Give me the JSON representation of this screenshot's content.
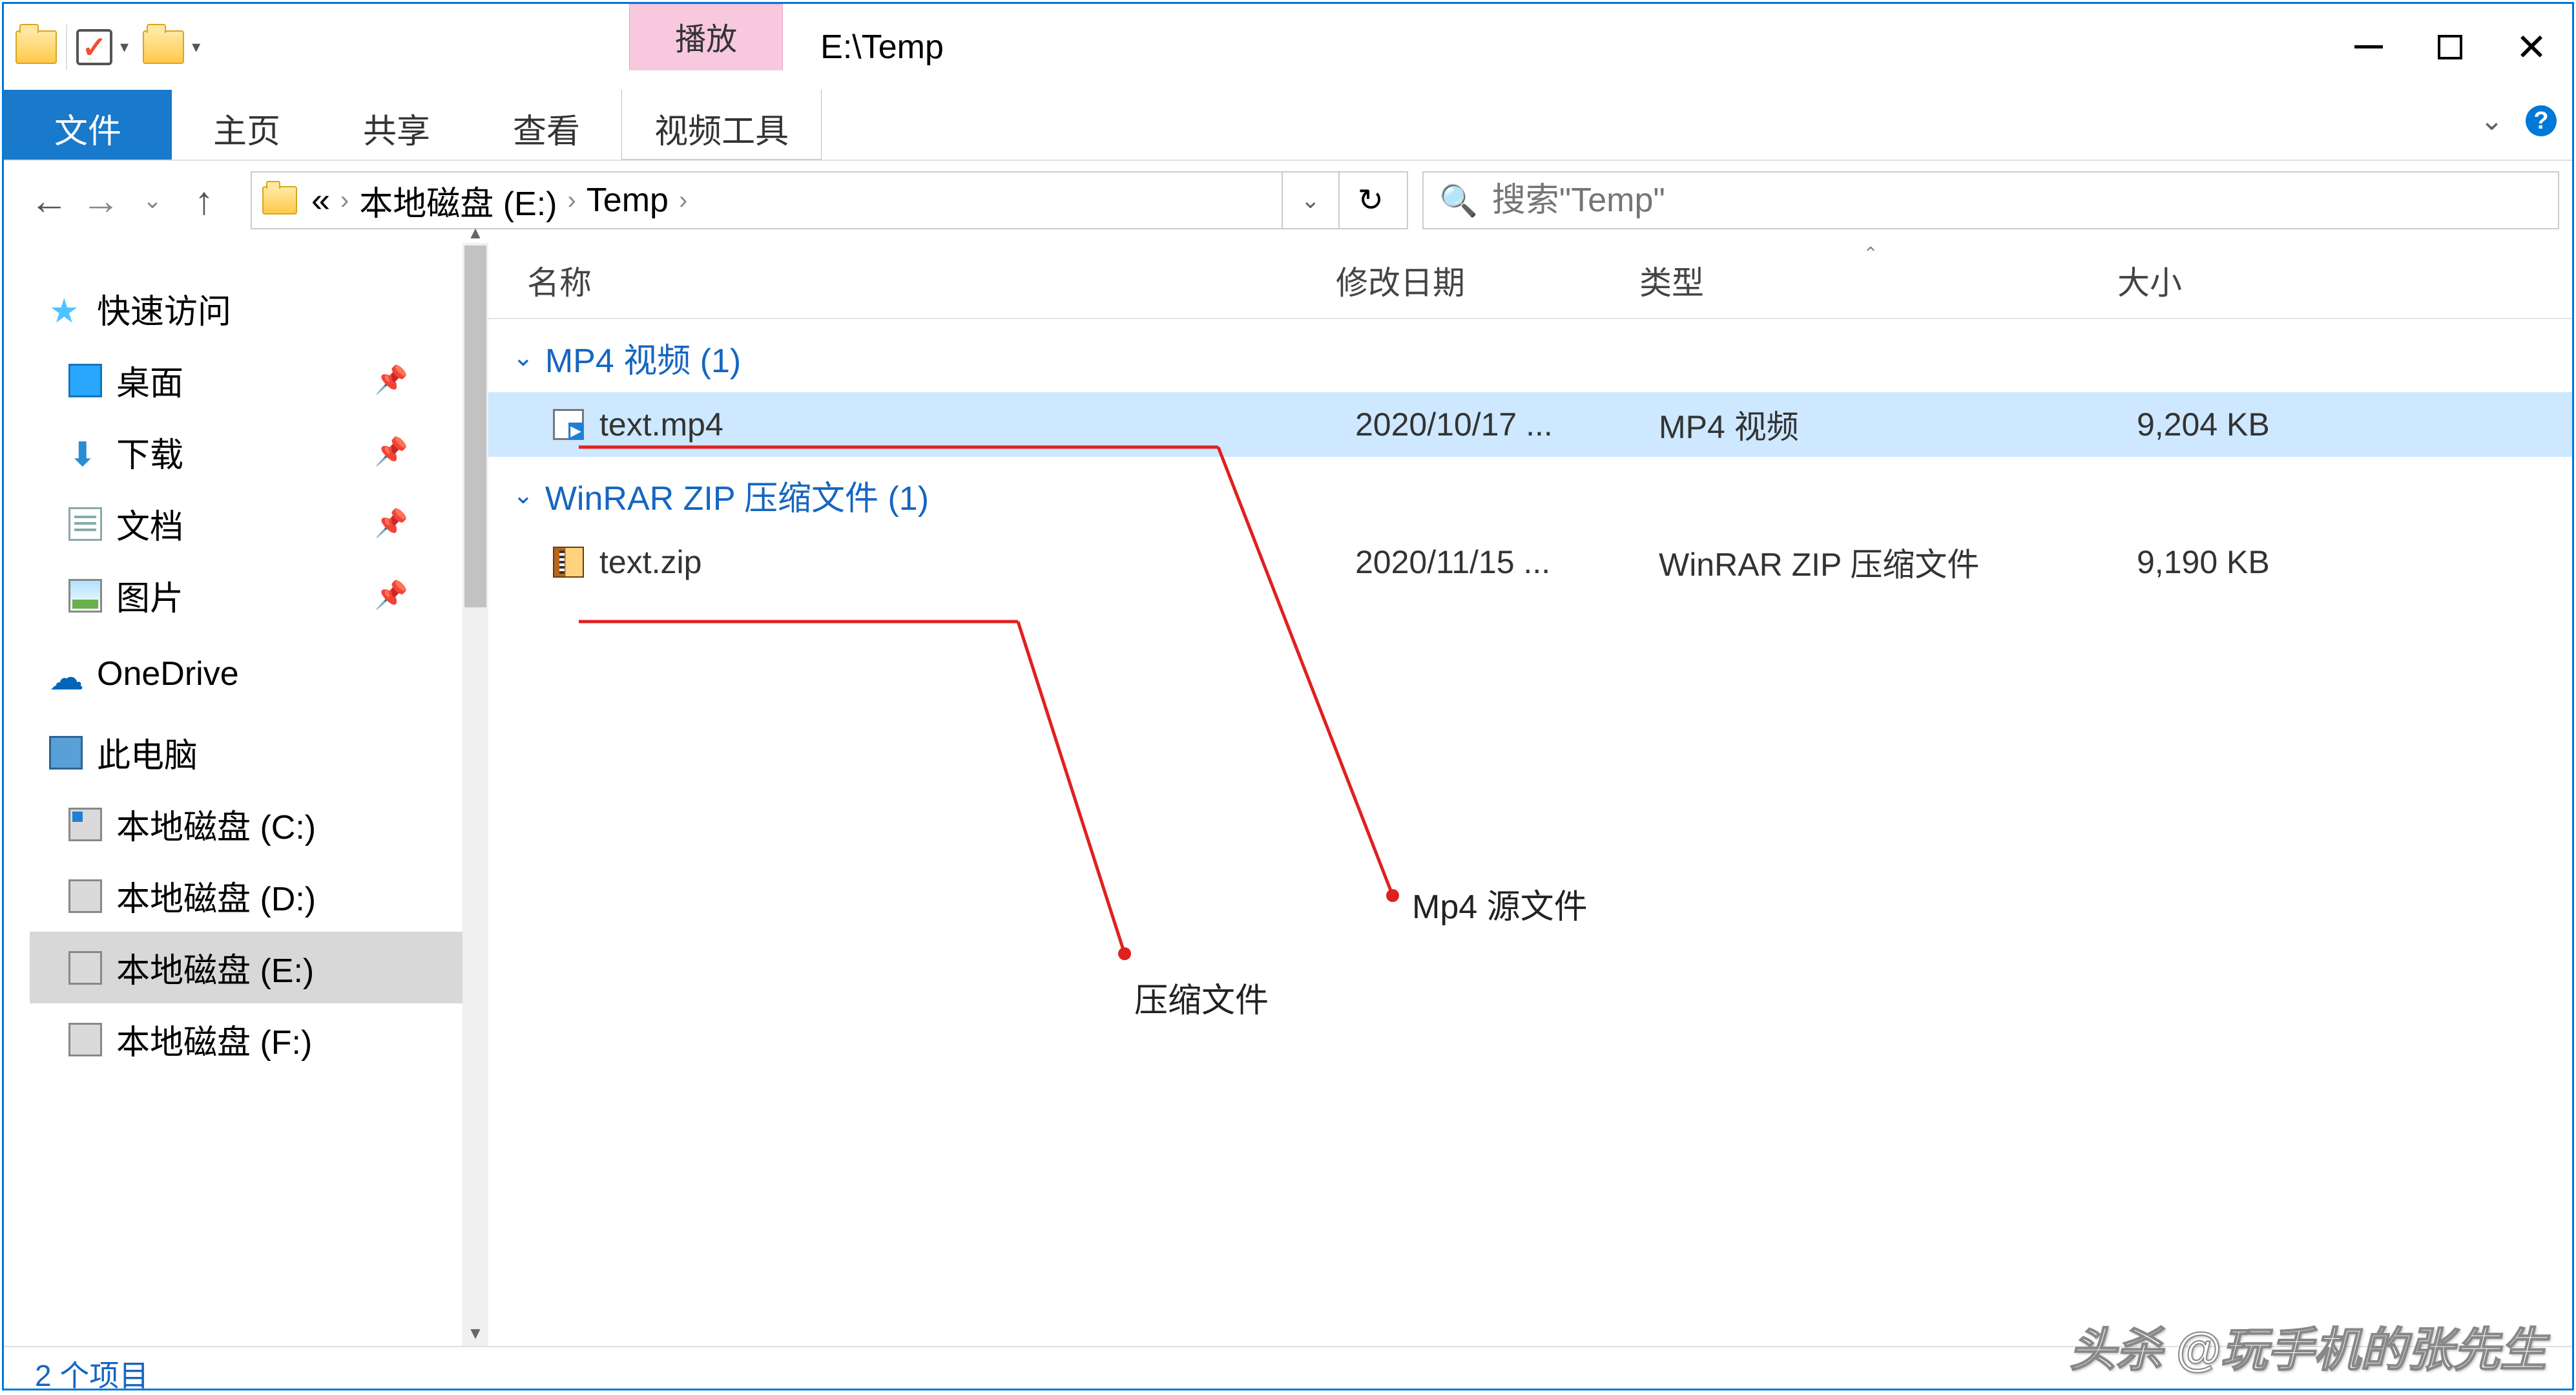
{
  "window": {
    "title": "E:\\Temp"
  },
  "titlebar": {
    "ctx_tab": "播放"
  },
  "ribbon": {
    "file": "文件",
    "home": "主页",
    "share": "共享",
    "view": "查看",
    "video_tools": "视频工具"
  },
  "address": {
    "crumbs": [
      "«",
      "本地磁盘 (E:)",
      "Temp"
    ],
    "search_placeholder": "搜索\"Temp\""
  },
  "nav": {
    "quick_access": "快速访问",
    "desktop": "桌面",
    "downloads": "下载",
    "documents": "文档",
    "pictures": "图片",
    "onedrive": "OneDrive",
    "this_pc": "此电脑",
    "drive_c": "本地磁盘 (C:)",
    "drive_d": "本地磁盘 (D:)",
    "drive_e": "本地磁盘 (E:)",
    "drive_f": "本地磁盘 (F:)"
  },
  "columns": {
    "name": "名称",
    "date": "修改日期",
    "type": "类型",
    "size": "大小"
  },
  "groups": [
    {
      "header": "MP4 视频 (1)",
      "files": [
        {
          "name": "text.mp4",
          "date": "2020/10/17 ...",
          "type": "MP4 视频",
          "size": "9,204 KB",
          "icon": "mp4",
          "selected": true
        }
      ]
    },
    {
      "header": "WinRAR ZIP 压缩文件 (1)",
      "files": [
        {
          "name": "text.zip",
          "date": "2020/11/15 ...",
          "type": "WinRAR ZIP 压缩文件",
          "size": "9,190 KB",
          "icon": "zip",
          "selected": false
        }
      ]
    }
  ],
  "annotations": {
    "mp4_src": "Mp4 源文件",
    "zip_file": "压缩文件"
  },
  "status": {
    "items": "2 个项目"
  },
  "watermark": "头杀 @玩手机的张先生"
}
